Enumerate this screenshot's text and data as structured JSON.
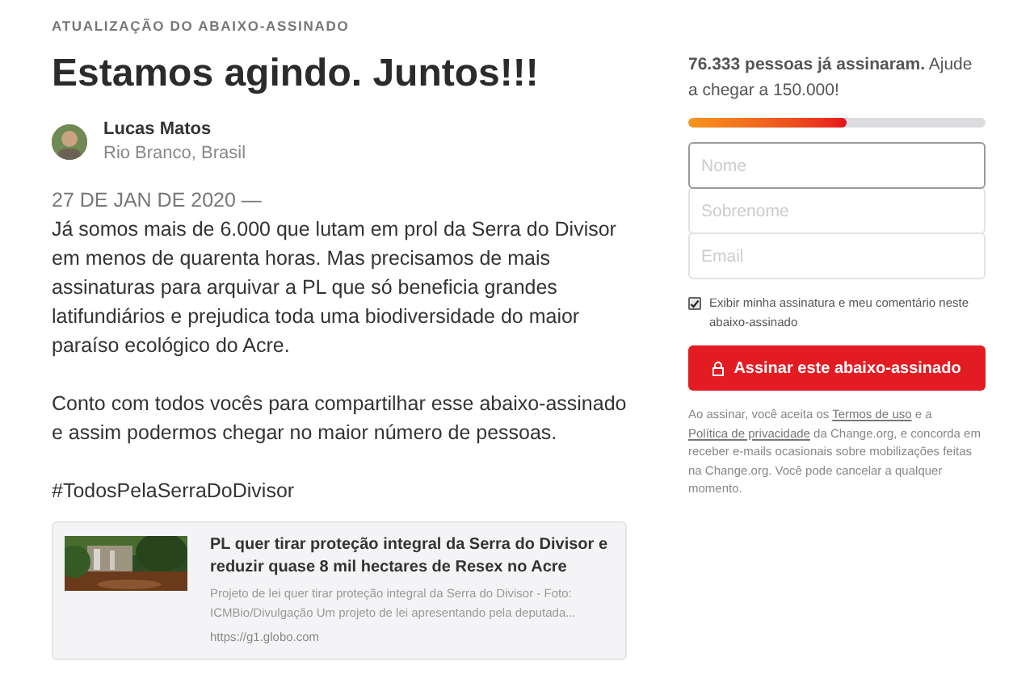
{
  "eyebrow": "ATUALIZAÇÃO DO ABAIXO-ASSINADO",
  "title": "Estamos agindo. Juntos!!!",
  "author": {
    "name": "Lucas Matos",
    "location": "Rio Branco, Brasil"
  },
  "date": "27 DE JAN DE 2020 —",
  "paragraphs": [
    "Já somos mais de 6.000 que lutam em prol da Serra do Divisor em menos de quarenta horas. Mas precisamos de mais assinaturas para arquivar a PL que só beneficia grandes latifundiários e prejudica toda uma biodiversidade do maior paraíso ecológico do Acre.",
    "Conto com todos vocês para compartilhar esse abaixo-assinado e assim podermos chegar no maior número de pessoas."
  ],
  "hashtag": "#TodosPelaSerraDoDivisor",
  "link_card": {
    "kind": "picture",
    "title": "PL quer tirar proteção integral da Serra do Divisor e reduzir quase 8 mil hectares de Resex no Acre",
    "description": "Projeto de lei quer tirar proteção integral da Serra do Divisor - Foto: ICMBio/Divulgação Um projeto de lei apresentando pela deputada...",
    "url": "https://g1.globo.com"
  },
  "progress": {
    "text": "**76.333 pessoas já assinaram.** Ajude a chegar a 150.000!",
    "level": 0.53
  },
  "fields": [
    {
      "placeholder": "Nome",
      "focused": true
    },
    {
      "placeholder": "Sobrenome",
      "focused": false
    },
    {
      "placeholder": "Email",
      "focused": false
    }
  ],
  "show_signature": {
    "label": "Exibir minha assinatura e meu comentário neste abaixo-assinado",
    "checked": true
  },
  "sign_button": "Assinar este abaixo-assinado",
  "legal": [
    {
      "kind": "text",
      "text": "Ao assinar, você aceita os "
    },
    {
      "kind": "link",
      "text": "Termos de uso"
    },
    {
      "kind": "text",
      "text": " e a "
    },
    {
      "kind": "link",
      "text": "Política de privacidade"
    },
    {
      "kind": "text",
      "text": " da Change.org, e concorda em receber e-mails ocasionais sobre mobilizações feitas na Change.org. Você pode cancelar a qualquer momento."
    }
  ]
}
